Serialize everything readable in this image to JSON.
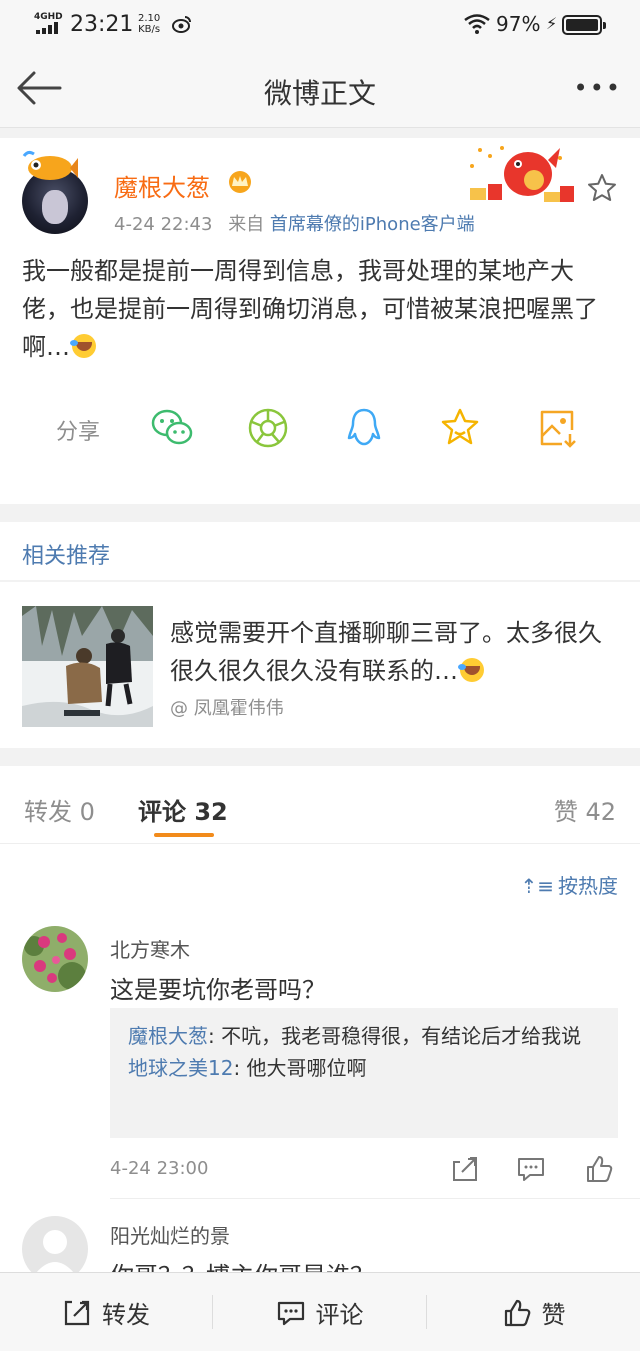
{
  "status_bar": {
    "network": "4GHD",
    "time": "23:21",
    "speed_value": "2.10",
    "speed_unit": "KB/s",
    "battery_percent": "97%"
  },
  "nav": {
    "title": "微博正文",
    "back_icon": "back-arrow-icon",
    "more_icon": "more-dots-icon"
  },
  "post": {
    "author": "魔根大葱",
    "timestamp": "4-24 22:43",
    "source_prefix": "来自",
    "source": "首席幕僚的iPhone客户端",
    "text": "我一般都是提前一周得到信息，我哥处理的某地产大佬，也是提前一周得到确切消息，可惜被某浪把喔黑了啊…",
    "share_label": "分享",
    "share_targets": [
      "wechat",
      "moments",
      "qq",
      "favorite",
      "save-image"
    ]
  },
  "related": {
    "title": "相关推荐",
    "item_text": "感觉需要开个直播聊聊三哥了。太多很久很久很久很久没有联系的…",
    "item_author": "@ 凤凰霍伟伟"
  },
  "tabs": {
    "repost": "转发 0",
    "comments": "评论 32",
    "likes": "赞 42",
    "active": "comments"
  },
  "comments": {
    "sort_label": "按热度",
    "items": [
      {
        "name": "北方寒木",
        "text": "这是要坑你老哥吗？",
        "replies": [
          {
            "name": "魔根大葱",
            "text": ": 不吭，我老哥稳得很，有结论后才给我说"
          },
          {
            "name": "地球之美12",
            "text": ": 他大哥哪位啊"
          }
        ],
        "time": "4-24 23:00"
      },
      {
        "name": "阳光灿烂的景",
        "text": "你哥？？博主你哥是谁？"
      }
    ]
  },
  "bottom_bar": {
    "repost": "转发",
    "comment": "评论",
    "like": "赞"
  },
  "colors": {
    "username": "#f86c14",
    "link": "#4e7bb0",
    "accent": "#f28b1b"
  }
}
